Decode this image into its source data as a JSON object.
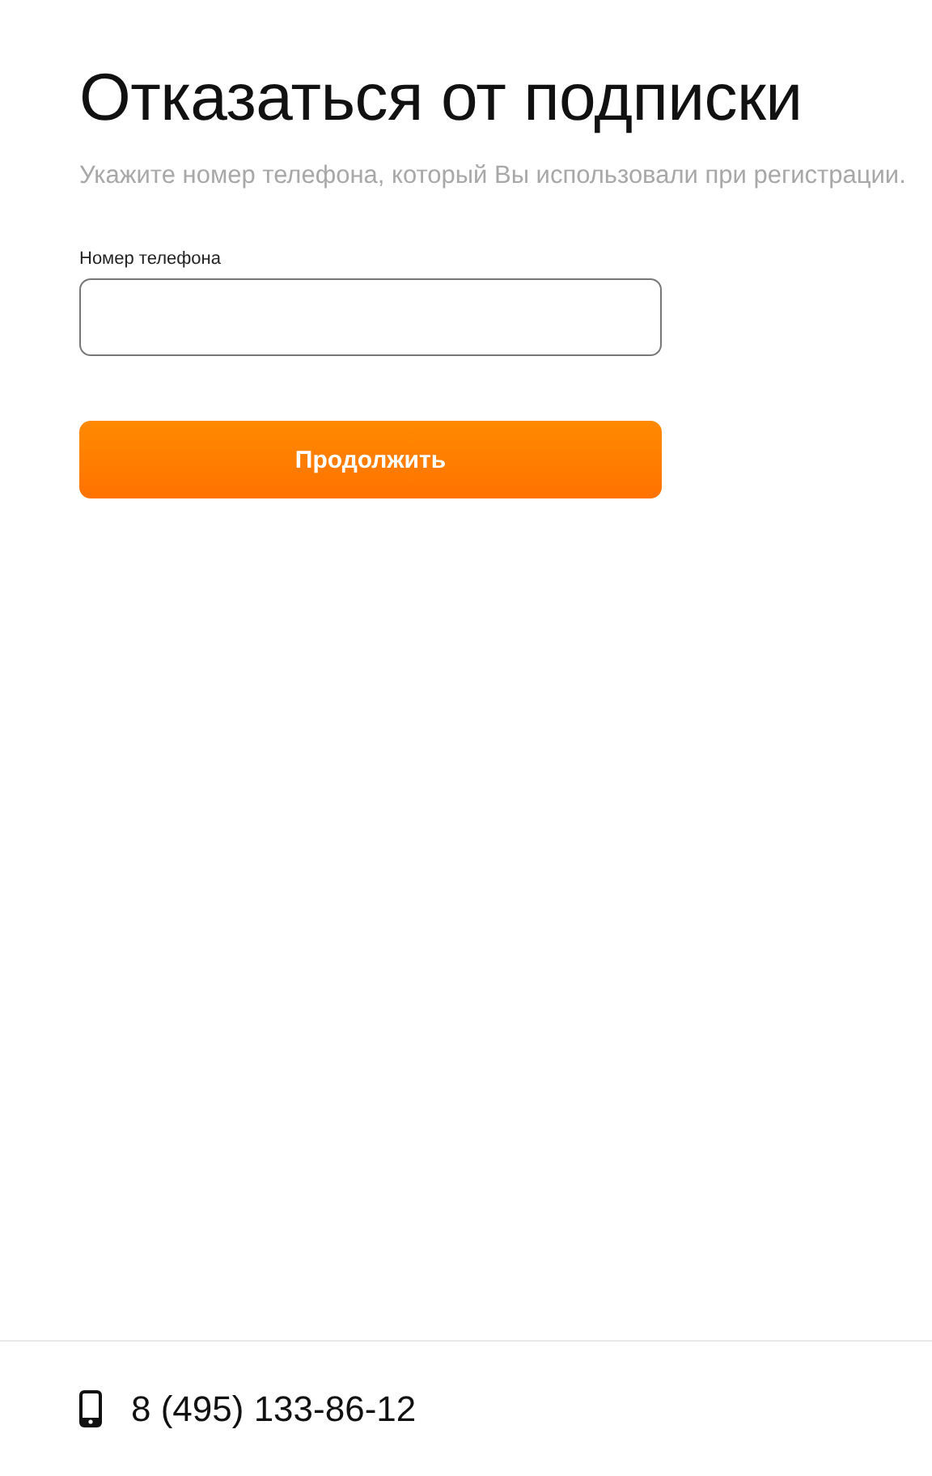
{
  "page": {
    "title": "Отказаться от подписки",
    "subtitle": "Укажите номер телефона, который Вы использовали при регистрации."
  },
  "form": {
    "phone_field": {
      "label": "Номер телефона"
    },
    "submit_button": "Продолжить"
  },
  "footer": {
    "phone": "8 (495) 133-86-12"
  }
}
